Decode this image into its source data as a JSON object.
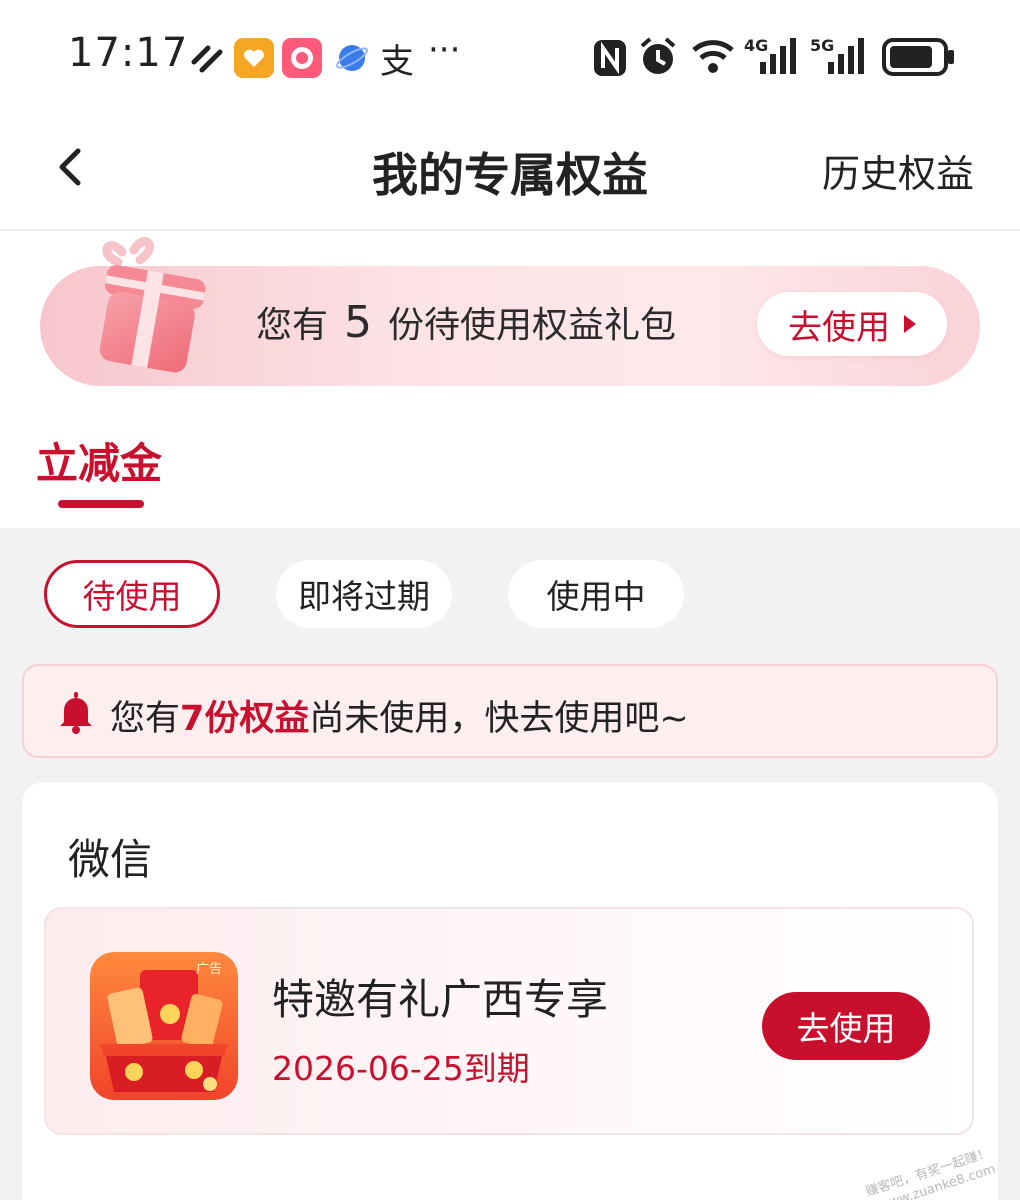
{
  "status_bar": {
    "time": "17:17",
    "app_icons": [
      "heart-app-icon",
      "618-app-icon",
      "planet-app-icon",
      "alipay-icon",
      "more-icon"
    ],
    "alipay_glyph": "支",
    "more_glyph": "···",
    "right_icons": [
      "nfc-icon",
      "alarm-icon",
      "wifi-icon",
      "signal-4g-icon",
      "signal-5g-icon",
      "battery-icon"
    ],
    "net_4g": "4G",
    "net_5g": "5G"
  },
  "nav": {
    "title": "我的专属权益",
    "history": "历史权益"
  },
  "banner": {
    "prefix": "您有",
    "count": "5",
    "suffix": "份待使用权益礼包",
    "button": "去使用"
  },
  "tabs": {
    "main": "立减金"
  },
  "filters": [
    {
      "label": "待使用",
      "active": true
    },
    {
      "label": "即将过期",
      "active": false
    },
    {
      "label": "使用中",
      "active": false
    }
  ],
  "notice": {
    "prefix": "您有",
    "highlight": "7份权益",
    "suffix": "尚未使用，快去使用吧~"
  },
  "card": {
    "title": "微信",
    "item": {
      "ad_tag": "广告",
      "name": "特邀有礼广西专享",
      "expiry": "2026-06-25到期",
      "button": "去使用"
    }
  },
  "watermark": {
    "line1": "赚客吧，有奖一起赚！",
    "line2": "www.zuanke8.com"
  },
  "colors": {
    "accent": "#c8102e",
    "page_bg": "#f2f2f2"
  }
}
